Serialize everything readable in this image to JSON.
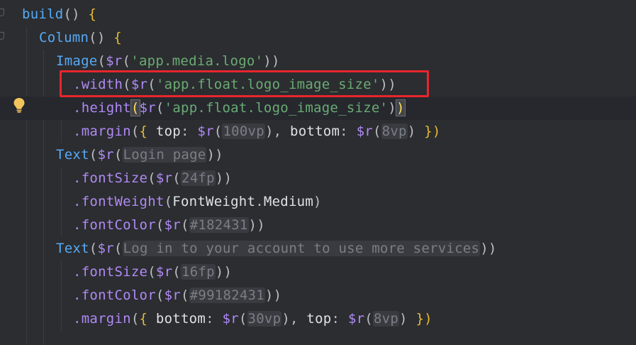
{
  "code_lines": [
    {
      "tokens": [
        {
          "t": "build",
          "c": "fn"
        },
        {
          "t": "() ",
          "c": "paren"
        },
        {
          "t": "{",
          "c": "brace"
        }
      ]
    },
    {
      "tokens": [
        {
          "t": "Column",
          "c": "cls"
        },
        {
          "t": "() ",
          "c": "paren"
        },
        {
          "t": "{",
          "c": "brace"
        }
      ]
    },
    {
      "tokens": [
        {
          "t": "Image",
          "c": "cls"
        },
        {
          "t": "(",
          "c": "paren"
        },
        {
          "t": "$r",
          "c": "dollar"
        },
        {
          "t": "(",
          "c": "paren"
        },
        {
          "t": "'app.media.logo'",
          "c": "str"
        },
        {
          "t": "))",
          "c": "paren"
        }
      ]
    },
    {
      "tokens": [
        {
          "t": ".width",
          "c": "meth"
        },
        {
          "t": "(",
          "c": "paren"
        },
        {
          "t": "$r",
          "c": "dollar"
        },
        {
          "t": "(",
          "c": "paren"
        },
        {
          "t": "'app.float.logo_image_size'",
          "c": "str"
        },
        {
          "t": "))",
          "c": "paren"
        }
      ]
    },
    {
      "tokens": [
        {
          "t": ".height",
          "c": "meth"
        },
        {
          "t": "(",
          "c": "match"
        },
        {
          "t": "$r",
          "c": "dollar"
        },
        {
          "t": "(",
          "c": "paren"
        },
        {
          "t": "'app.float.logo_image_size'",
          "c": "str"
        },
        {
          "t": ")",
          "c": "paren"
        },
        {
          "t": ")",
          "c": "match"
        }
      ]
    },
    {
      "tokens": [
        {
          "t": ".margin",
          "c": "meth"
        },
        {
          "t": "(",
          "c": "paren"
        },
        {
          "t": "{ ",
          "c": "brace"
        },
        {
          "t": "top",
          "c": "white"
        },
        {
          "t": ": ",
          "c": "plain"
        },
        {
          "t": "$r",
          "c": "dollar"
        },
        {
          "t": "(",
          "c": "paren"
        },
        {
          "t": "100vp",
          "c": "hint",
          "chip": true
        },
        {
          "t": ")",
          "c": "paren"
        },
        {
          "t": ", ",
          "c": "plain"
        },
        {
          "t": "bottom",
          "c": "white"
        },
        {
          "t": ": ",
          "c": "plain"
        },
        {
          "t": "$r",
          "c": "dollar"
        },
        {
          "t": "(",
          "c": "paren"
        },
        {
          "t": "8vp",
          "c": "hint",
          "chip": true
        },
        {
          "t": ") ",
          "c": "paren"
        },
        {
          "t": "})",
          "c": "brace"
        }
      ]
    },
    {
      "tokens": [
        {
          "t": "Text",
          "c": "cls"
        },
        {
          "t": "(",
          "c": "paren"
        },
        {
          "t": "$r",
          "c": "dollar"
        },
        {
          "t": "(",
          "c": "paren"
        },
        {
          "t": "Login page",
          "c": "hint",
          "chip": true
        },
        {
          "t": "))",
          "c": "paren"
        }
      ]
    },
    {
      "tokens": [
        {
          "t": ".fontSize",
          "c": "meth"
        },
        {
          "t": "(",
          "c": "paren"
        },
        {
          "t": "$r",
          "c": "dollar"
        },
        {
          "t": "(",
          "c": "paren"
        },
        {
          "t": "24fp",
          "c": "hint",
          "chip": true
        },
        {
          "t": "))",
          "c": "paren"
        }
      ]
    },
    {
      "tokens": [
        {
          "t": ".fontWeight",
          "c": "meth"
        },
        {
          "t": "(",
          "c": "paren"
        },
        {
          "t": "FontWeight",
          "c": "white"
        },
        {
          "t": ".",
          "c": "plain"
        },
        {
          "t": "Medium",
          "c": "white"
        },
        {
          "t": ")",
          "c": "paren"
        }
      ]
    },
    {
      "tokens": [
        {
          "t": ".fontColor",
          "c": "meth"
        },
        {
          "t": "(",
          "c": "paren"
        },
        {
          "t": "$r",
          "c": "dollar"
        },
        {
          "t": "(",
          "c": "paren"
        },
        {
          "t": "#182431",
          "c": "hint",
          "chip": true
        },
        {
          "t": "))",
          "c": "paren"
        }
      ]
    },
    {
      "tokens": [
        {
          "t": "Text",
          "c": "cls"
        },
        {
          "t": "(",
          "c": "paren"
        },
        {
          "t": "$r",
          "c": "dollar"
        },
        {
          "t": "(",
          "c": "paren"
        },
        {
          "t": "Log in to your account to use more services",
          "c": "hint",
          "chip": true
        },
        {
          "t": "))",
          "c": "paren"
        }
      ]
    },
    {
      "tokens": [
        {
          "t": ".fontSize",
          "c": "meth"
        },
        {
          "t": "(",
          "c": "paren"
        },
        {
          "t": "$r",
          "c": "dollar"
        },
        {
          "t": "(",
          "c": "paren"
        },
        {
          "t": "16fp",
          "c": "hint",
          "chip": true
        },
        {
          "t": "))",
          "c": "paren"
        }
      ]
    },
    {
      "tokens": [
        {
          "t": ".fontColor",
          "c": "meth"
        },
        {
          "t": "(",
          "c": "paren"
        },
        {
          "t": "$r",
          "c": "dollar"
        },
        {
          "t": "(",
          "c": "paren"
        },
        {
          "t": "#99182431",
          "c": "hint",
          "chip": true
        },
        {
          "t": "))",
          "c": "paren"
        }
      ]
    },
    {
      "tokens": [
        {
          "t": ".margin",
          "c": "meth"
        },
        {
          "t": "(",
          "c": "paren"
        },
        {
          "t": "{ ",
          "c": "brace"
        },
        {
          "t": "bottom",
          "c": "white"
        },
        {
          "t": ": ",
          "c": "plain"
        },
        {
          "t": "$r",
          "c": "dollar"
        },
        {
          "t": "(",
          "c": "paren"
        },
        {
          "t": "30vp",
          "c": "hint",
          "chip": true
        },
        {
          "t": ")",
          "c": "paren"
        },
        {
          "t": ", ",
          "c": "plain"
        },
        {
          "t": "top",
          "c": "white"
        },
        {
          "t": ": ",
          "c": "plain"
        },
        {
          "t": "$r",
          "c": "dollar"
        },
        {
          "t": "(",
          "c": "paren"
        },
        {
          "t": "8vp",
          "c": "hint",
          "chip": true
        },
        {
          "t": ") ",
          "c": "paren"
        },
        {
          "t": "})",
          "c": "brace"
        }
      ]
    }
  ],
  "current_line_index": 4,
  "highlighted_line_index": 3,
  "gutter_icons": {
    "fold": "fold-marker-icon",
    "intention": "lightbulb-icon"
  },
  "colors": {
    "background": "#2b2d30",
    "highlight_box": "#e8262d",
    "lightbulb": "#f2c55c"
  }
}
